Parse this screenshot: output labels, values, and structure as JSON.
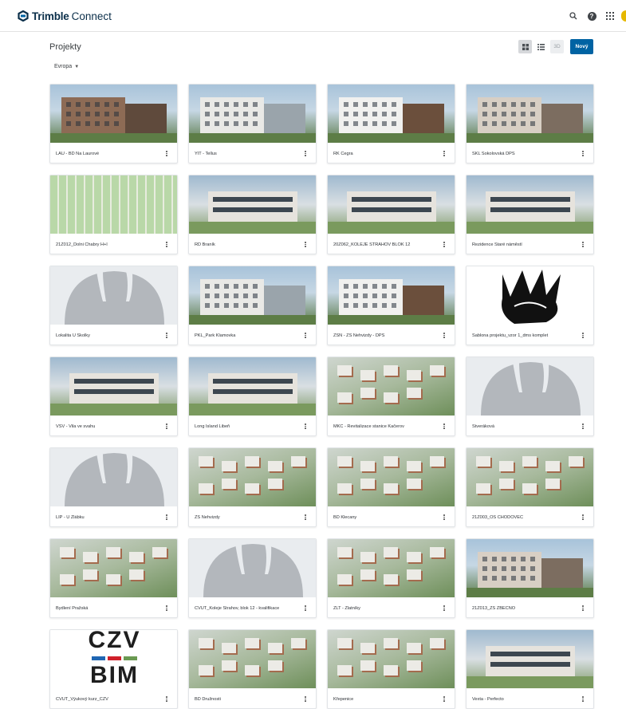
{
  "app": {
    "brand": "Trimble",
    "product": "Connect"
  },
  "header_icons": [
    "search-icon",
    "help-icon",
    "apps-grid-icon"
  ],
  "page": {
    "title": "Projekty",
    "region": "Evropa"
  },
  "toolbar": {
    "view_3d": "3D",
    "new_button": "Nový"
  },
  "projects": [
    {
      "name": "LAU - BD Na Laurové",
      "thumb": "building"
    },
    {
      "name": "YIT - Tellus",
      "thumb": "building"
    },
    {
      "name": "RK Cegra",
      "thumb": "building"
    },
    {
      "name": "SKL Sokolovská DPS",
      "thumb": "building"
    },
    {
      "name": "21Z012_Dolni Chabry H+I",
      "thumb": "plan"
    },
    {
      "name": "RD Braník",
      "thumb": "cgi"
    },
    {
      "name": "20Z062_KOLEJE STRAHOV BLOK 12",
      "thumb": "cgi"
    },
    {
      "name": "Rezidence Staré náměstí",
      "thumb": "cgi"
    },
    {
      "name": "Lokalita U Školky",
      "thumb": "blank"
    },
    {
      "name": "PKL_Park Klamovka",
      "thumb": "building"
    },
    {
      "name": "ZSN - ZŠ Nehvizdy - DPS",
      "thumb": "building"
    },
    {
      "name": "Šablona projektu_vzor 1_dms komplet",
      "thumb": "hand"
    },
    {
      "name": "VSV - Vila ve svahu",
      "thumb": "cgi"
    },
    {
      "name": "Long Island Libeň",
      "thumb": "cgi"
    },
    {
      "name": "MKC - Revitalizace stanice Kačerov",
      "thumb": "aerial"
    },
    {
      "name": "Štveráková",
      "thumb": "blank"
    },
    {
      "name": "LIP - U Žlábku",
      "thumb": "blank"
    },
    {
      "name": "ZŠ Nehvizdy",
      "thumb": "aerial"
    },
    {
      "name": "BD Klecany",
      "thumb": "aerial"
    },
    {
      "name": "21Z003_OS CHODOVEC",
      "thumb": "aerial"
    },
    {
      "name": "Bydlení Pražská",
      "thumb": "aerial"
    },
    {
      "name": "CVUT_Koleje Strahov, blok 12 - kvalifikace",
      "thumb": "blank"
    },
    {
      "name": "ZLT - Zlatníky",
      "thumb": "aerial"
    },
    {
      "name": "21Z013_ZS ZBECNO",
      "thumb": "building"
    },
    {
      "name": "CVUT_Výukový kurz_ČZV",
      "thumb": "czv",
      "logo_text": [
        "ČZV",
        "BIM"
      ]
    },
    {
      "name": "BD Družnosti",
      "thumb": "aerial"
    },
    {
      "name": "Křepenice",
      "thumb": "aerial"
    },
    {
      "name": "Vexta - Perfecto",
      "thumb": "cgi"
    }
  ],
  "colors": {
    "accent": "#0063a3",
    "brand": "#0b2f4a",
    "placeholder_bg": "#e9ecef",
    "placeholder_icon": "#b3b7bc"
  }
}
